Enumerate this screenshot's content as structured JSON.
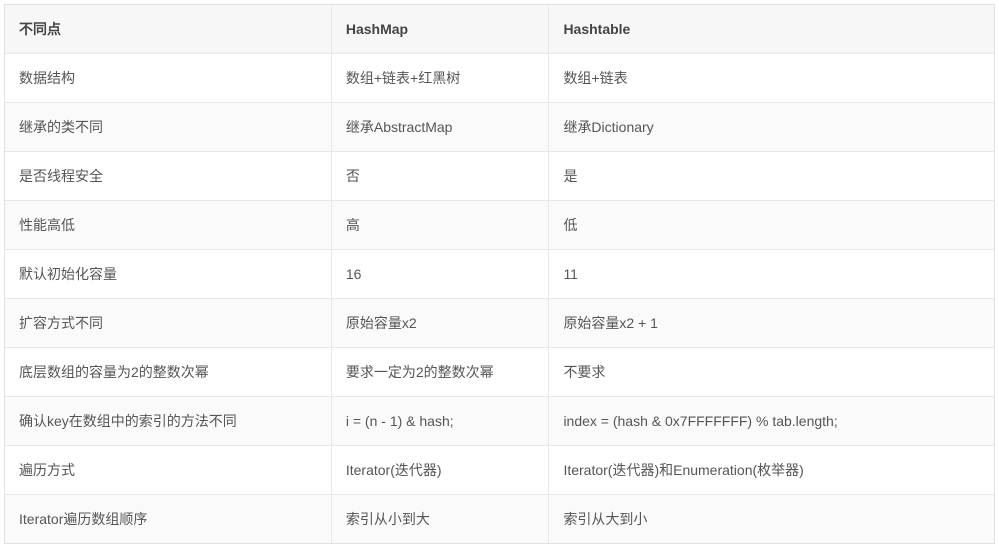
{
  "table": {
    "headers": [
      "不同点",
      "HashMap",
      "Hashtable"
    ],
    "rows": [
      [
        "数据结构",
        "数组+链表+红黑树",
        "数组+链表"
      ],
      [
        "继承的类不同",
        "继承AbstractMap",
        "继承Dictionary"
      ],
      [
        "是否线程安全",
        "否",
        "是"
      ],
      [
        "性能高低",
        "高",
        "低"
      ],
      [
        "默认初始化容量",
        "16",
        "11"
      ],
      [
        "扩容方式不同",
        "原始容量x2",
        "原始容量x2 + 1"
      ],
      [
        "底层数组的容量为2的整数次幂",
        "要求一定为2的整数次幂",
        "不要求"
      ],
      [
        "确认key在数组中的索引的方法不同",
        "i = (n - 1) & hash;",
        "index = (hash & 0x7FFFFFFF) % tab.length;"
      ],
      [
        "遍历方式",
        "Iterator(迭代器)",
        "Iterator(迭代器)和Enumeration(枚举器)"
      ],
      [
        "Iterator遍历数组顺序",
        "索引从小到大",
        "索引从大到小"
      ]
    ]
  }
}
